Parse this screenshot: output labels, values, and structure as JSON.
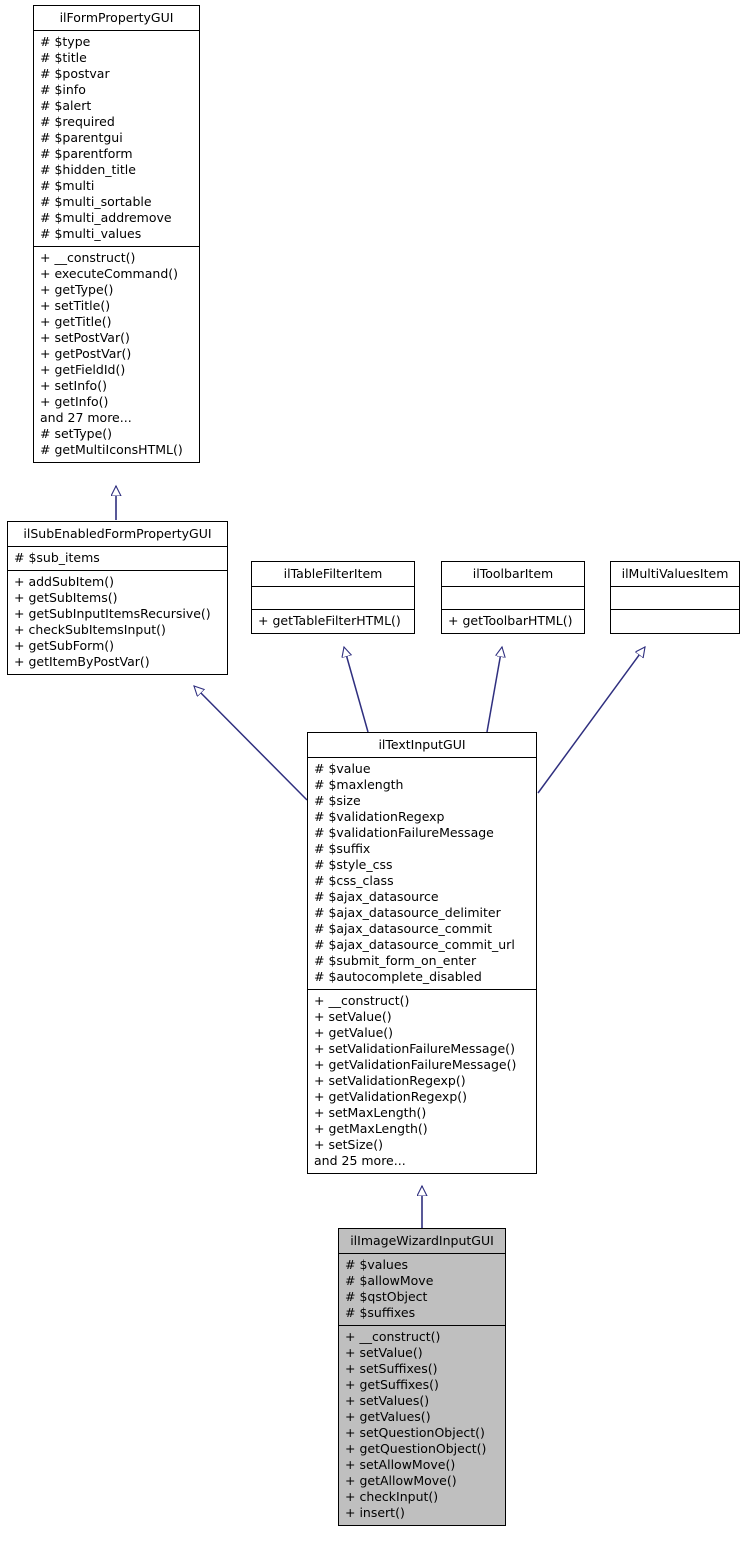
{
  "diagram": {
    "type": "uml-class-inheritance-diagram",
    "background": "#ffffff",
    "edge_color": "#2f2f7f",
    "highlight_fill": "#bfbfbf",
    "border_color": "#000000"
  },
  "classes": {
    "form_property": {
      "name": "ilFormPropertyGUI",
      "attributes": [
        "# $type",
        "# $title",
        "# $postvar",
        "# $info",
        "# $alert",
        "# $required",
        "# $parentgui",
        "# $parentform",
        "# $hidden_title",
        "# $multi",
        "# $multi_sortable",
        "# $multi_addremove",
        "# $multi_values"
      ],
      "methods": [
        "+ __construct()",
        "+ executeCommand()",
        "+ getType()",
        "+ setTitle()",
        "+ getTitle()",
        "+ setPostVar()",
        "+ getPostVar()",
        "+ getFieldId()",
        "+ setInfo()",
        "+ getInfo()",
        "and 27 more...",
        "# setType()",
        "# getMultiIconsHTML()"
      ]
    },
    "sub_enabled": {
      "name": "ilSubEnabledFormPropertyGUI",
      "attributes": [
        "# $sub_items"
      ],
      "methods": [
        "+ addSubItem()",
        "+ getSubItems()",
        "+ getSubInputItemsRecursive()",
        "+ checkSubItemsInput()",
        "+ getSubForm()",
        "+ getItemByPostVar()"
      ]
    },
    "table_filter": {
      "name": "ilTableFilterItem",
      "attributes": [],
      "methods": [
        "+ getTableFilterHTML()"
      ]
    },
    "toolbar_item": {
      "name": "ilToolbarItem",
      "attributes": [],
      "methods": [
        "+ getToolbarHTML()"
      ]
    },
    "multi_values": {
      "name": "ilMultiValuesItem",
      "attributes": [],
      "methods": []
    },
    "text_input": {
      "name": "ilTextInputGUI",
      "attributes": [
        "# $value",
        "# $maxlength",
        "# $size",
        "# $validationRegexp",
        "# $validationFailureMessage",
        "# $suffix",
        "# $style_css",
        "# $css_class",
        "# $ajax_datasource",
        "# $ajax_datasource_delimiter",
        "# $ajax_datasource_commit",
        "# $ajax_datasource_commit_url",
        "# $submit_form_on_enter",
        "# $autocomplete_disabled"
      ],
      "methods": [
        "+ __construct()",
        "+ setValue()",
        "+ getValue()",
        "+ setValidationFailureMessage()",
        "+ getValidationFailureMessage()",
        "+ setValidationRegexp()",
        "+ getValidationRegexp()",
        "+ setMaxLength()",
        "+ getMaxLength()",
        "+ setSize()",
        "and 25 more..."
      ]
    },
    "image_wizard": {
      "name": "ilImageWizardInputGUI",
      "attributes": [
        "# $values",
        "# $allowMove",
        "# $qstObject",
        "# $suffixes"
      ],
      "methods": [
        "+ __construct()",
        "+ setValue()",
        "+ setSuffixes()",
        "+ getSuffixes()",
        "+ setValues()",
        "+ getValues()",
        "+ setQuestionObject()",
        "+ getQuestionObject()",
        "+ setAllowMove()",
        "+ getAllowMove()",
        "+ checkInput()",
        "+ insert()"
      ]
    }
  }
}
